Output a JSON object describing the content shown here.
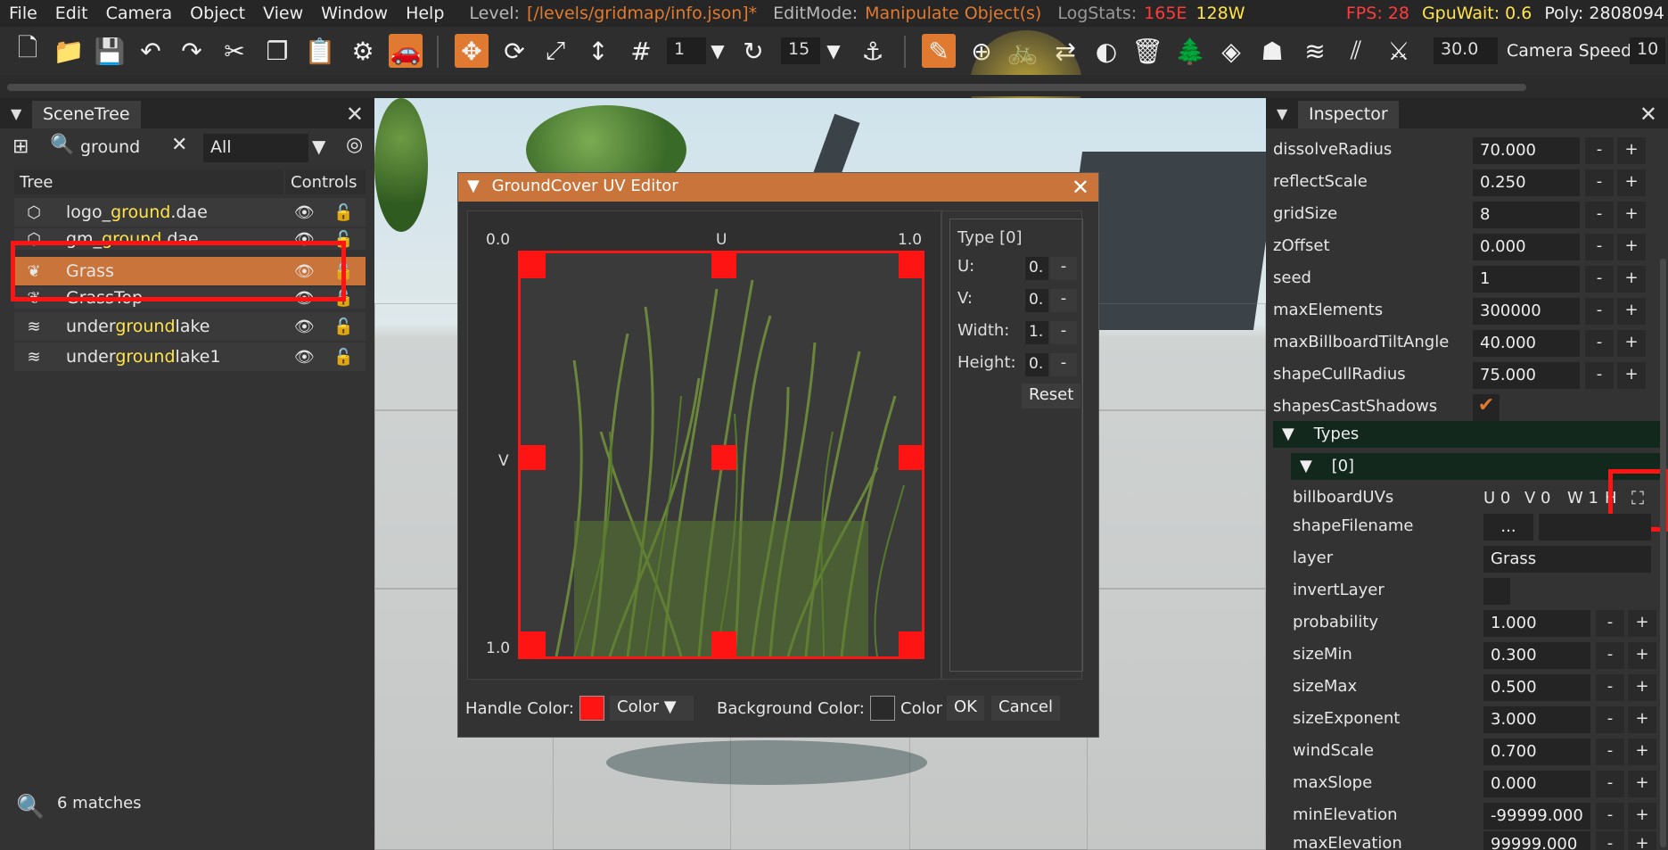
{
  "menubar": {
    "items": [
      "File",
      "Edit",
      "Camera",
      "Object",
      "View",
      "Window",
      "Help"
    ],
    "level_label": "Level:",
    "level_value": "[/levels/gridmap/info.json]*",
    "editmode_label": "EditMode:",
    "editmode_value": "Manipulate Object(s)",
    "logstats_label": "LogStats:",
    "logstats_errors": "165E",
    "logstats_warnings": "128W",
    "fps": "FPS: 28",
    "gpuwait": "GpuWait: 0.6",
    "poly": "Poly: 2808094"
  },
  "toolbar": {
    "snap_value": "1",
    "rotate_value": "15",
    "speed_value": "30.0",
    "camera_speed_label": "Camera Speed",
    "camera_speed_value": "10"
  },
  "scenetree": {
    "title": "SceneTree",
    "search_value": "ground",
    "filter_value": "All",
    "col_tree": "Tree",
    "col_controls": "Controls",
    "matches": "6 matches",
    "rows": [
      {
        "pre": "logo_",
        "hl": "ground",
        "post": ".dae"
      },
      {
        "pre": "gm_",
        "hl": "ground",
        "post": ".dae"
      },
      {
        "pre": "Grass",
        "hl": "",
        "post": ""
      },
      {
        "pre": "GrassTop",
        "hl": "",
        "post": ""
      },
      {
        "pre": "under",
        "hl": "ground",
        "post": "lake"
      },
      {
        "pre": "under",
        "hl": "ground",
        "post": "lake1"
      }
    ]
  },
  "dialog": {
    "title": "GroundCover UV Editor",
    "u_min": "0.0",
    "u_label": "U",
    "u_max": "1.0",
    "v_label": "V",
    "v_max": "1.0",
    "type_label": "Type [0]",
    "fields": [
      {
        "label": "U:",
        "value": "0."
      },
      {
        "label": "V:",
        "value": "0."
      },
      {
        "label": "Width:",
        "value": "1."
      },
      {
        "label": "Height:",
        "value": "0."
      }
    ],
    "reset": "Reset",
    "handle_color_label": "Handle Color:",
    "color_btn": "Color",
    "background_color_label": "Background Color:",
    "color_btn2": "Color",
    "ok": "OK",
    "cancel": "Cancel",
    "handle_color": "#ff1414"
  },
  "inspector": {
    "title": "Inspector",
    "props": [
      {
        "label": "dissolveRadius",
        "value": "70.000"
      },
      {
        "label": "reflectScale",
        "value": "0.250"
      },
      {
        "label": "gridSize",
        "value": "8"
      },
      {
        "label": "zOffset",
        "value": "0.000"
      },
      {
        "label": "seed",
        "value": "1"
      },
      {
        "label": "maxElements",
        "value": "300000"
      },
      {
        "label": "maxBillboardTiltAngle",
        "value": "40.000"
      },
      {
        "label": "shapeCullRadius",
        "value": "75.000"
      }
    ],
    "shapes_cast_shadows": "shapesCastShadows",
    "types_label": "Types",
    "type0_label": "[0]",
    "billboard_label": "billboardUVs",
    "billboard_u": "U 0",
    "billboard_v": "V 0",
    "billboard_w": "W 1",
    "billboard_h": "H",
    "shape_filename_label": "shapeFilename",
    "shape_filename_btn": "...",
    "layer_label": "layer",
    "layer_value": "Grass",
    "invert_layer_label": "invertLayer",
    "type_props": [
      {
        "label": "probability",
        "value": "1.000"
      },
      {
        "label": "sizeMin",
        "value": "0.300"
      },
      {
        "label": "sizeMax",
        "value": "0.500"
      },
      {
        "label": "sizeExponent",
        "value": "3.000"
      },
      {
        "label": "windScale",
        "value": "0.700"
      },
      {
        "label": "maxSlope",
        "value": "0.000"
      },
      {
        "label": "minElevation",
        "value": "-99999.000"
      },
      {
        "label": "maxElevation",
        "value": "99999.000"
      }
    ],
    "minus": "-",
    "plus": "+"
  },
  "colors": {
    "accent": "#c9743a",
    "highlight": "#ffe44d",
    "annotation_red": "#ff1414"
  }
}
